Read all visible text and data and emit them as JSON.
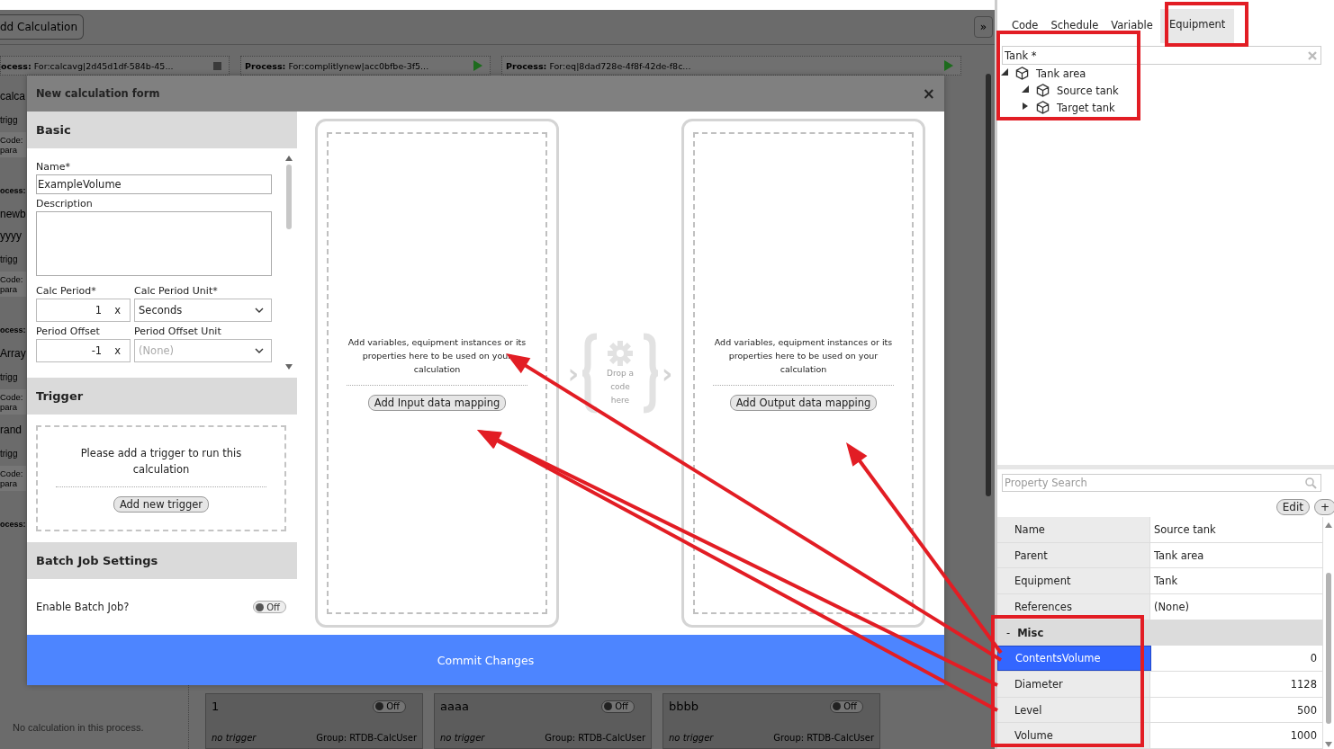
{
  "background": {
    "add_button": "dd Calculation",
    "collapse_button": "»",
    "process_tabs": [
      {
        "label": "**ocess:** For:calcavg|2d45d1df-584b-45...",
        "running": false
      },
      {
        "label": "**Process:** For:complitlynew|acc0bfbe-3f5...",
        "running": true
      },
      {
        "label": "**Process:** For:eq|8dad728e-4f8f-42de-f8c...",
        "running": true
      }
    ],
    "side_fragments": [
      {
        "kind": "title",
        "text": "calca"
      },
      {
        "kind": "meta",
        "text": "trigg"
      },
      {
        "kind": "code",
        "lines": [
          "Code:",
          "para"
        ]
      },
      {
        "kind": "process",
        "text": "ocess:"
      },
      {
        "kind": "title",
        "text": "newb"
      },
      {
        "kind": "title",
        "text": "yyyy"
      },
      {
        "kind": "meta",
        "text": "trigg"
      },
      {
        "kind": "code",
        "lines": [
          "Code:",
          "para"
        ]
      },
      {
        "kind": "process",
        "text": "ocess:"
      },
      {
        "kind": "title",
        "text": "Array"
      },
      {
        "kind": "meta",
        "text": "trigg"
      },
      {
        "kind": "code",
        "lines": [
          "Code:",
          "para"
        ]
      },
      {
        "kind": "title",
        "text": "rand"
      },
      {
        "kind": "meta",
        "text": "trigg"
      },
      {
        "kind": "code",
        "lines": [
          "Code:",
          "para"
        ]
      },
      {
        "kind": "process",
        "text": "ocess:"
      }
    ],
    "empty_note": "No calculation in this process.",
    "cards": [
      {
        "title": "1",
        "on": false,
        "toggle": "Off",
        "trigger": "no trigger",
        "group": "Group: RTDB-CalcUser"
      },
      {
        "title": "aaaa",
        "on": false,
        "toggle": "Off",
        "trigger": "no trigger",
        "group": "Group: RTDB-CalcUser"
      },
      {
        "title": "bbbb",
        "on": false,
        "toggle": "Off",
        "trigger": "no trigger",
        "group": "Group: RTDB-CalcUser"
      }
    ]
  },
  "modal": {
    "title": "New calculation form",
    "close": "×",
    "basic": {
      "heading": "Basic",
      "name": {
        "label": "Name*",
        "value": "ExampleVolume"
      },
      "description": {
        "label": "Description"
      },
      "rows": [
        [
          {
            "kind": "number",
            "label": "Calc Period*",
            "value": "1",
            "clear": "x"
          },
          {
            "kind": "select",
            "label": "Calc Period Unit*",
            "value": "Seconds"
          }
        ],
        [
          {
            "kind": "number",
            "label": "Period Offset",
            "value": "-1",
            "clear": "x"
          },
          {
            "kind": "select",
            "label": "Period Offset Unit",
            "placeholder": "(None)"
          }
        ]
      ]
    },
    "trigger": {
      "heading": "Trigger",
      "message": "Please add a trigger to run this calculation",
      "button": "Add new trigger"
    },
    "batch": {
      "heading": "Batch Job Settings",
      "label": "Enable Batch Job?",
      "on": false,
      "toggle": "Off"
    },
    "input": {
      "message": "Add variables, equipment instances or its properties here to be used on your calculation",
      "button": "Add Input data mapping"
    },
    "code_drop": {
      "chevron": "›",
      "text": "Drop a code here"
    },
    "output": {
      "message": "Add variables, equipment instances or its properties here to be used on your calculation",
      "button": "Add Output data mapping"
    },
    "commit": "Commit Changes"
  },
  "right_panel": {
    "tabs": [
      {
        "label": "Code",
        "selected": false
      },
      {
        "label": "Schedule",
        "selected": false
      },
      {
        "label": "Variable",
        "selected": false
      },
      {
        "label": "Equipment",
        "selected": true
      }
    ],
    "search": {
      "value": "Tank *"
    },
    "tree": [
      {
        "label": "Tank area",
        "expanded": true,
        "children": [
          {
            "label": "Source tank",
            "expanded": true
          },
          {
            "label": "Target tank",
            "expanded": false
          }
        ]
      }
    ],
    "property_search": {
      "placeholder": "Property Search"
    },
    "buttons": [
      "Edit",
      "+"
    ],
    "properties": [
      {
        "kind": "text",
        "name": "Name",
        "value": "Source tank",
        "selected": false
      },
      {
        "kind": "text",
        "name": "Parent",
        "value": "Tank area",
        "selected": false
      },
      {
        "kind": "text",
        "name": "Equipment",
        "value": "Tank",
        "selected": false
      },
      {
        "kind": "text",
        "name": "References",
        "value": "(None)",
        "selected": false
      },
      {
        "kind": "group",
        "name": "Misc",
        "toggle": "-"
      },
      {
        "kind": "number",
        "name": "ContentsVolume",
        "value": "0",
        "selected": true
      },
      {
        "kind": "number",
        "name": "Diameter",
        "value": "1128",
        "selected": false
      },
      {
        "kind": "number",
        "name": "Level",
        "value": "500",
        "selected": false
      },
      {
        "kind": "number",
        "name": "Volume",
        "value": "1000",
        "selected": false
      }
    ]
  }
}
